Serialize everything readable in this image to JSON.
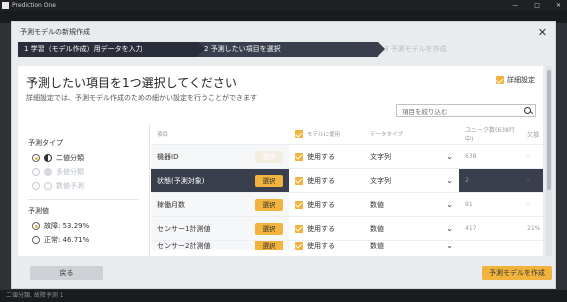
{
  "app": {
    "title": "Prediction One"
  },
  "window": {
    "controls": [
      "—",
      "□",
      "✕"
    ]
  },
  "modal": {
    "title": "予測モデルの新規作成",
    "close_icon": "close-icon",
    "steps": [
      {
        "label": "1 学習（モデル作成）用データを入力",
        "state": "done"
      },
      {
        "label": "2 予測したい項目を選択",
        "state": "active"
      },
      {
        "label": "3 予測モデルを作成",
        "state": "inactive"
      }
    ],
    "headline": "予測したい項目を1つ選択してください",
    "subline": "詳細設定では、予測モデル作成のための細かい設定を行うことができます",
    "advanced_label": "詳細設定",
    "search_placeholder": "項目を絞り込む",
    "left": {
      "type_title": "予測タイプ",
      "types": [
        {
          "label": "二値分類",
          "selected": true,
          "enabled": true
        },
        {
          "label": "多値分類",
          "selected": false,
          "enabled": false
        },
        {
          "label": "数値予測",
          "selected": false,
          "enabled": false
        }
      ],
      "value_title": "予測値",
      "values": [
        {
          "label": "故障: 53.29%",
          "selected": true
        },
        {
          "label": "正常: 46.71%",
          "selected": false
        }
      ]
    },
    "table": {
      "headers": [
        "項目",
        "モデルに使用",
        "データタイプ",
        "ユニーク数(638行中)",
        "欠損"
      ],
      "select_label": "選択",
      "use_label": "使用する",
      "rows": [
        {
          "name": "機器ID",
          "type": "文字列",
          "unique": "638",
          "missing": "-",
          "selected": false,
          "btn_enabled": false
        },
        {
          "name": "状態(予測対象)",
          "type": "文字列",
          "unique": "2",
          "missing": "-",
          "selected": true,
          "btn_enabled": true
        },
        {
          "name": "稼働月数",
          "type": "数値",
          "unique": "91",
          "missing": "-",
          "selected": false,
          "btn_enabled": true
        },
        {
          "name": "センサー1計測値",
          "type": "数値",
          "unique": "417",
          "missing": "21%",
          "selected": false,
          "btn_enabled": true
        },
        {
          "name": "センサー2計測値",
          "type": "数値",
          "unique": "",
          "missing": "",
          "selected": false,
          "btn_enabled": true
        }
      ]
    },
    "back_label": "戻る",
    "create_label": "予測モデルを作成"
  },
  "background_bottom_text": "二値分類, 故障予測 1"
}
